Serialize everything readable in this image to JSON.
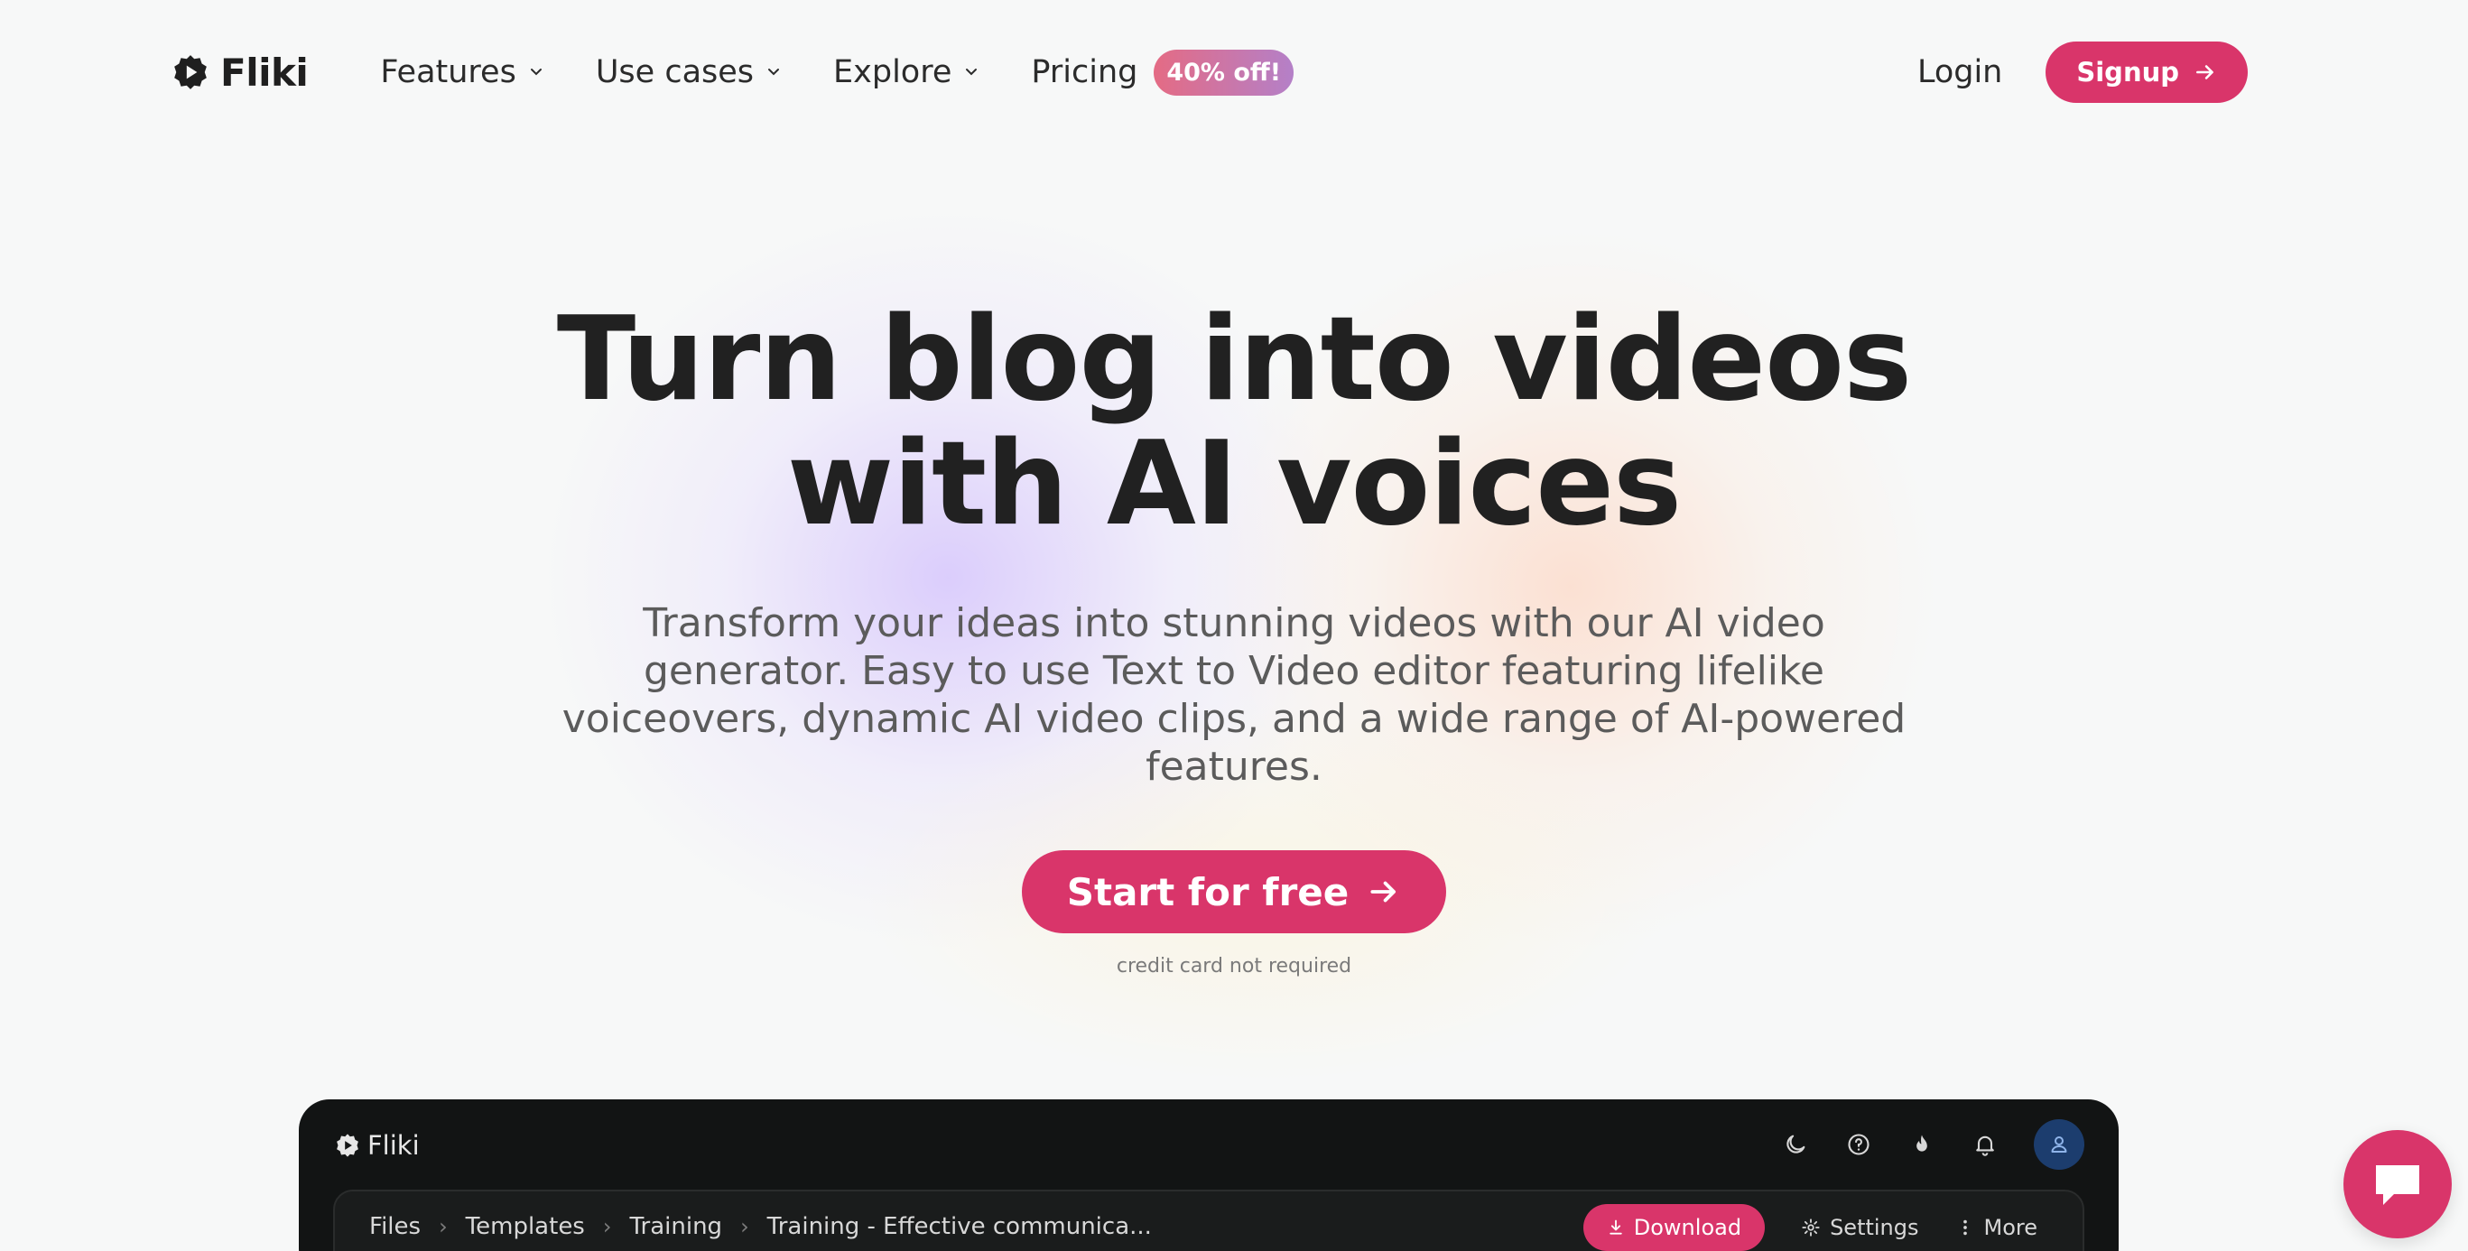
{
  "nav": {
    "brand": "Fliki",
    "links": [
      {
        "label": "Features",
        "dropdown": true
      },
      {
        "label": "Use cases",
        "dropdown": true
      },
      {
        "label": "Explore",
        "dropdown": true
      },
      {
        "label": "Pricing",
        "dropdown": false
      }
    ],
    "pricing_badge": "40% off!",
    "login": "Login",
    "signup": "Signup"
  },
  "hero": {
    "title_line1": "Turn blog into videos",
    "title_line2": "with AI voices",
    "subtitle": "Transform your ideas into stunning videos with our AI video generator. Easy to use Text to Video editor featuring lifelike voiceovers, dynamic AI video clips, and a wide range of AI-powered features.",
    "cta": "Start for free",
    "note": "credit card not required"
  },
  "app_preview": {
    "brand": "Fliki",
    "icons": [
      "moon-icon",
      "help-icon",
      "flame-icon",
      "bell-icon",
      "user-icon"
    ],
    "breadcrumbs": [
      "Files",
      "Templates",
      "Training",
      "Training - Effective communica..."
    ],
    "download": "Download",
    "settings": "Settings",
    "more": "More"
  },
  "colors": {
    "accent": "#d9356a",
    "background": "#f7f8f8",
    "app_background": "#121414",
    "badge_gradient_start": "#e46b84",
    "badge_gradient_end": "#b480c8"
  }
}
